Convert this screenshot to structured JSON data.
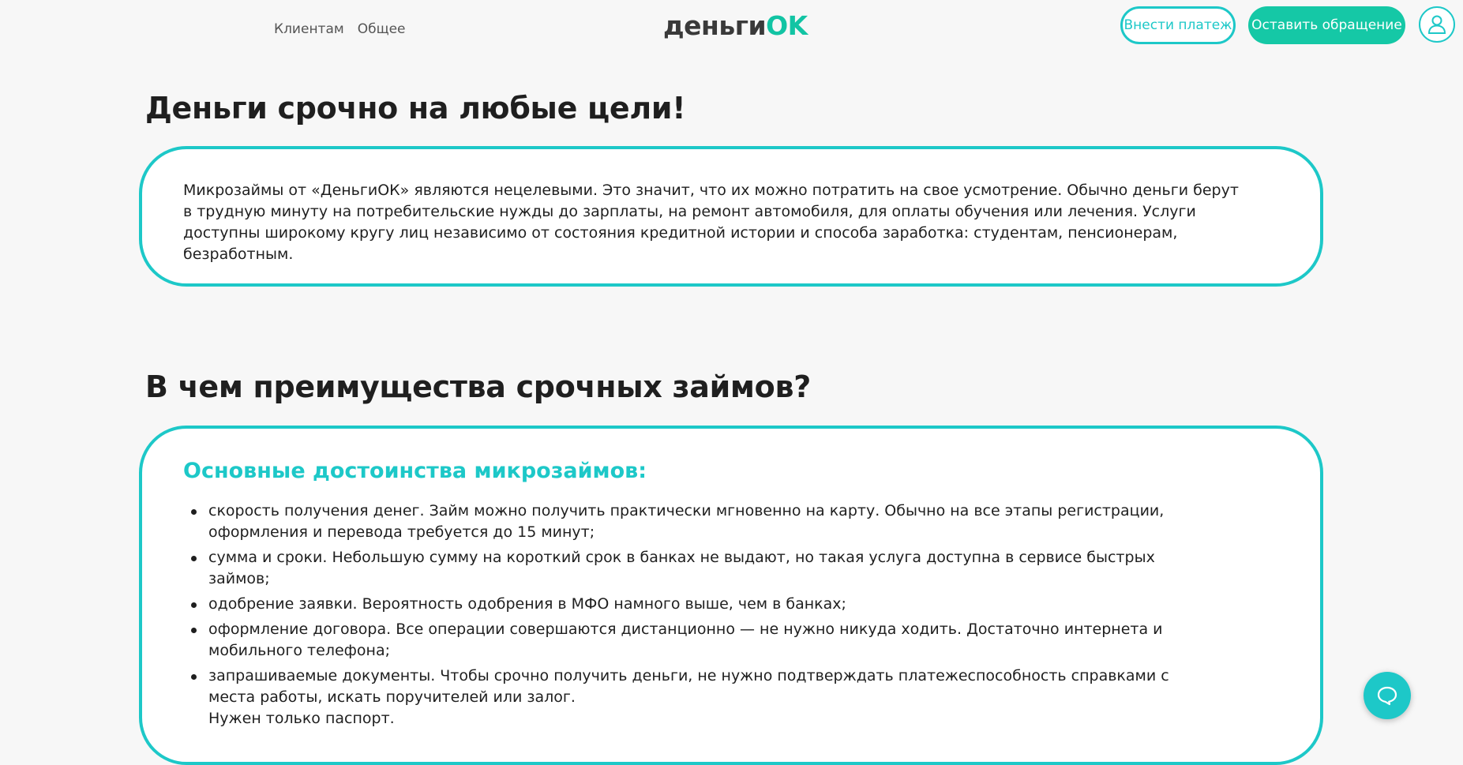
{
  "header": {
    "nav": [
      "Клиентам",
      "Общее"
    ],
    "logo_main": "деньги",
    "logo_accent": "OK",
    "pay_button": "Внести платеж",
    "request_button": "Оставить обращение"
  },
  "section1": {
    "title": "Деньги срочно на любые цели!",
    "text": "Микрозаймы от «ДеньгиОК» являются нецелевыми. Это значит, что их можно потратить на свое усмотрение. Обычно деньги берут в трудную минуту на потребительские нужды до зарплаты, на ремонт автомобиля, для оплаты обучения или лечения. Услуги доступны широкому кругу лиц независимо от состояния кредитной истории и способа заработка: студентам, пенсионерам, безработным."
  },
  "section2": {
    "title": "В чем преимущества срочных займов?",
    "subtitle": "Основные достоинства микрозаймов:",
    "items": [
      "скорость получения денег. Займ можно получить практически мгновенно на карту. Обычно на все этапы регистрации, оформления и перевода требуется до 15 минут;",
      "сумма и сроки. Небольшую сумму на короткий срок в банках не выдают, но такая услуга доступна в сервисе быстрых займов;",
      "одобрение заявки. Вероятность одобрения в МФО намного выше, чем в банках;",
      "оформление договора. Все операции совершаются дистанционно — не нужно никуда ходить. Достаточно интернета и мобильного телефона;",
      "запрашиваемые документы. Чтобы срочно получить деньги, не нужно подтверждать платежеспособность справками с места работы, искать поручителей или залог."
    ],
    "item5_extra": "Нужен только паспорт."
  },
  "colors": {
    "accent": "#1dc8c8",
    "brand_green": "#15c8a6",
    "background": "#f7f7f7"
  },
  "icons": {
    "user": "user-icon",
    "chat": "chat-icon"
  }
}
